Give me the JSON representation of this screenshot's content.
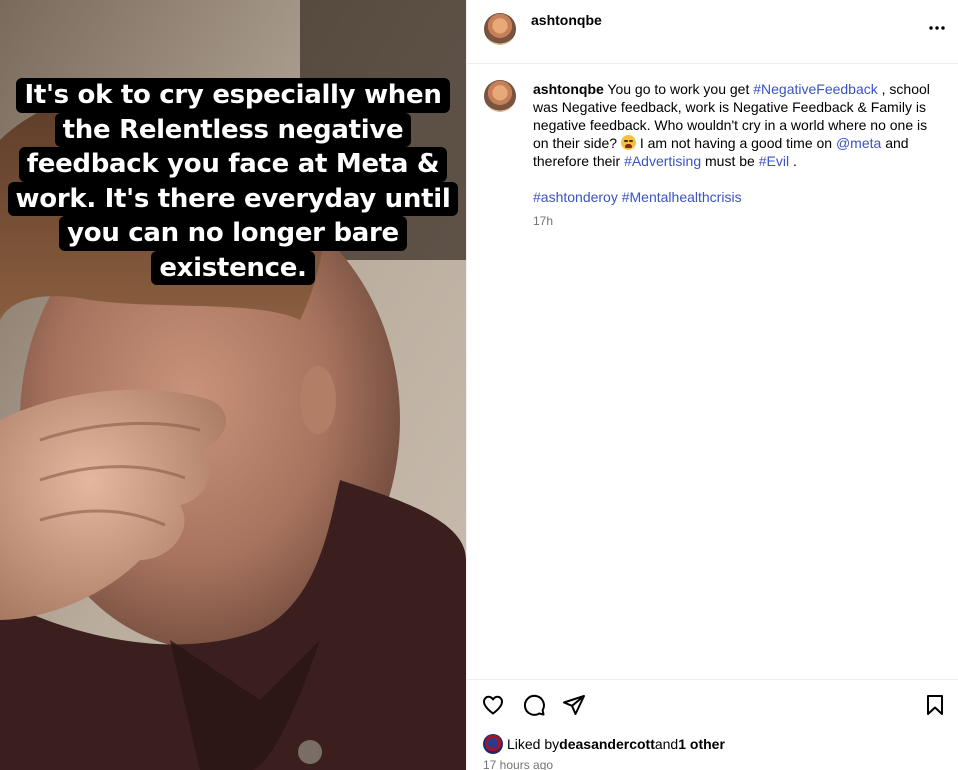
{
  "post": {
    "username": "ashtonqbe",
    "more_icon": "more-horizontal-icon",
    "image_caption": [
      "It's ok to cry especially when",
      "the Relentless negative",
      "feedback you face at Meta &",
      "work.  It's there everyday until",
      "you can no longer bare",
      "existence."
    ]
  },
  "comment": {
    "username": "ashtonqbe",
    "text_1": " You go to work you get ",
    "tag_negative": "#NegativeFeedback",
    "text_2": " , school was Negative feedback, work is Negative Feedback & Family is negative feedback. Who wouldn't cry in a world where no one is on their side? ",
    "emoji": "crying-face-emoji",
    "text_3": " I am not having a good time on ",
    "mention_meta": "@meta",
    "text_4": " and therefore their ",
    "tag_advertising": "#Advertising",
    "text_5": " must be ",
    "tag_evil": "#Evil",
    "text_6": " .",
    "tag_ashtonderoy": "#ashtonderoy",
    "tag_mentalhealth": "#Mentalhealthcrisis",
    "time": "17h"
  },
  "footer": {
    "icons": [
      "heart-icon",
      "comment-icon",
      "share-icon",
      "bookmark-icon"
    ],
    "liked_by_prefix": "Liked by ",
    "liked_by_user": "deasandercott",
    "liked_by_and": " and ",
    "liked_by_others": "1 other",
    "time": "17 hours ago"
  },
  "colors": {
    "link": "#3a53c0",
    "muted": "#737373",
    "divider": "#efefef"
  }
}
